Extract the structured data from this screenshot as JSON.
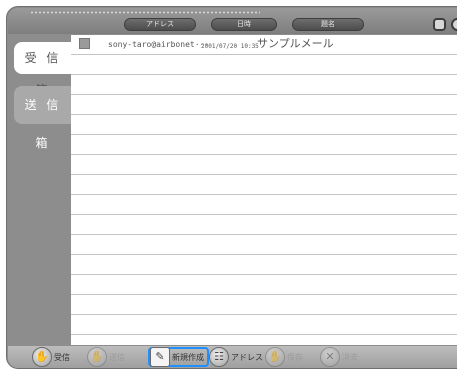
{
  "header": {
    "sort_buttons": [
      "アドレス",
      "日時",
      "題名"
    ]
  },
  "folders": {
    "inbox": "受 信 箱",
    "sent": "送 信 箱"
  },
  "messages": [
    {
      "from": "sony-taro@airbonet···",
      "date": "2001/07/20 10:35",
      "subject": "サンプルメール"
    }
  ],
  "toolbar": {
    "receive": "受信",
    "send": "送信",
    "compose": "新規作成",
    "address": "アドレス",
    "save": "保存",
    "delete": "消去"
  },
  "icons": [
    "receive-icon",
    "send-icon",
    "compose-icon",
    "address-book-icon",
    "save-icon",
    "delete-icon"
  ]
}
